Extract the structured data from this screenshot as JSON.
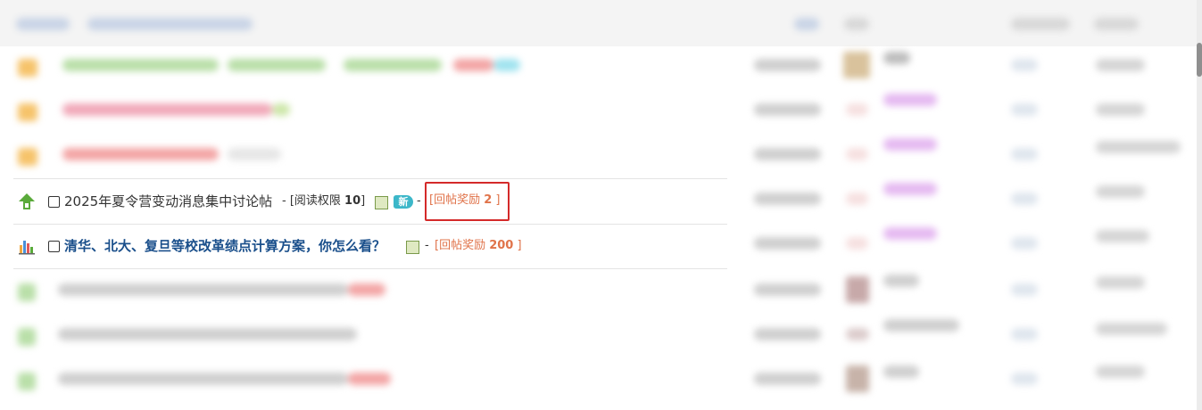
{
  "rows": [
    {
      "title": "2025年夏令营变动消息集中讨论帖",
      "read_perm_prefix": "- [阅读权限 ",
      "read_perm_value": "10",
      "read_perm_suffix": "]",
      "new_badge": "新",
      "dash": "-",
      "reward_label": "[回帖奖励 ",
      "reward_value": "2",
      "reward_suffix": " ]",
      "icon": "arrow-up-icon"
    },
    {
      "title": "清华、北大、复旦等校改革绩点计算方案，你怎么看？",
      "dash": "-",
      "reward_label": "[回帖奖励 ",
      "reward_value": "200",
      "reward_suffix": " ]",
      "icon": "bar-chart-icon"
    }
  ],
  "colors": {
    "highlight_border": "#d42a2a",
    "reward_text": "#e0734a",
    "bold_title": "#1a4f8b",
    "up_arrow": "#5aaa3a"
  }
}
